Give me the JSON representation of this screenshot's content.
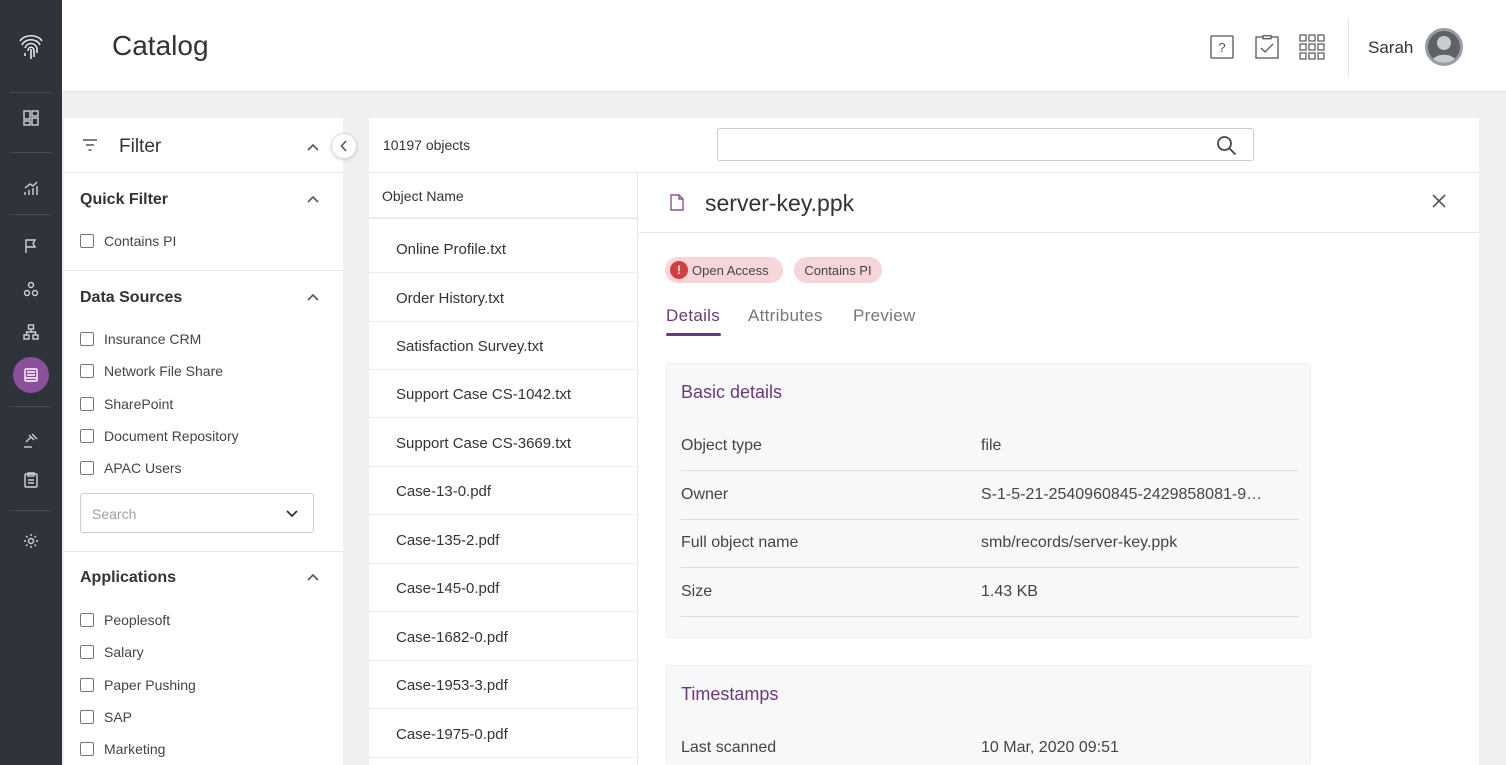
{
  "header": {
    "title": "Catalog",
    "user_name": "Sarah",
    "icons": [
      "help-icon",
      "tasks-check-icon",
      "apps-grid-icon"
    ]
  },
  "rail": {
    "icons": [
      "fingerprint-logo-icon",
      "dashboard-icon",
      "chart-icon",
      "flag-icon",
      "graph-icon",
      "hierarchy-icon",
      "catalog-icon",
      "gavel-icon",
      "clipboard-icon",
      "settings-icon"
    ],
    "active": "catalog-icon",
    "active_color": "#8b4f9d"
  },
  "filter": {
    "title": "Filter",
    "quick_filter": {
      "title": "Quick Filter",
      "options": [
        "Contains PI"
      ]
    },
    "data_sources": {
      "title": "Data Sources",
      "options": [
        "Insurance CRM",
        "Network File Share",
        "SharePoint",
        "Document Repository",
        "APAC Users"
      ],
      "search_placeholder": "Search"
    },
    "applications": {
      "title": "Applications",
      "options": [
        "Peoplesoft",
        "Salary",
        "Paper Pushing",
        "SAP",
        "Marketing"
      ]
    }
  },
  "main": {
    "object_count": "10197 objects",
    "search_placeholder": "",
    "column_header": "Object Name",
    "objects": [
      "Online Profile.txt",
      "Order History.txt",
      "Satisfaction Survey.txt",
      "Support Case CS-1042.txt",
      "Support Case CS-3669.txt",
      "Case-13-0.pdf",
      "Case-135-2.pdf",
      "Case-145-0.pdf",
      "Case-1682-0.pdf",
      "Case-1953-3.pdf",
      "Case-1975-0.pdf"
    ]
  },
  "detail": {
    "file_name": "server-key.ppk",
    "badges": [
      "Open Access",
      "Contains PI"
    ],
    "tabs": [
      "Details",
      "Attributes",
      "Preview"
    ],
    "active_tab": "Details",
    "basic_details": {
      "title": "Basic details",
      "rows": [
        {
          "key": "Object type",
          "value": "file"
        },
        {
          "key": "Owner",
          "value": "S-1-5-21-2540960845-2429858081-9…"
        },
        {
          "key": "Full object name",
          "value": "smb/records/server-key.ppk"
        },
        {
          "key": "Size",
          "value": "1.43 KB"
        }
      ]
    },
    "timestamps": {
      "title": "Timestamps",
      "rows": [
        {
          "key": "Last scanned",
          "value": "10 Mar, 2020 09:51"
        }
      ]
    }
  },
  "colors": {
    "accent": "#6b3a7c",
    "rail_bg": "#2f343b",
    "badge_bg": "#f6d6d8",
    "error": "#d83c3c"
  }
}
